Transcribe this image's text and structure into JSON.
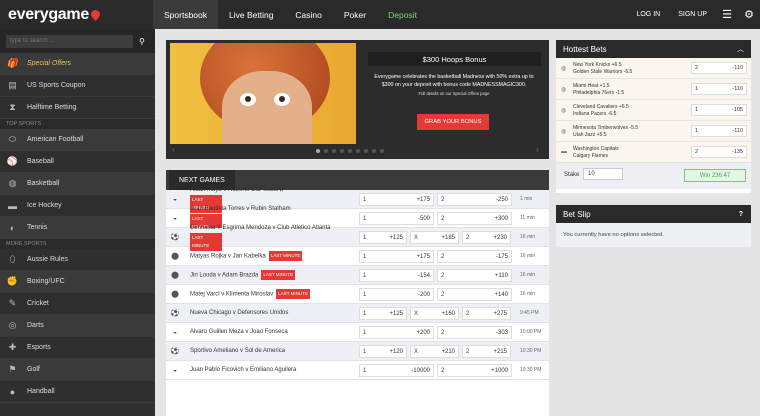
{
  "brand": {
    "name": "everygame",
    "accent": "#e53935"
  },
  "nav": {
    "tabs": [
      {
        "label": "Sportsbook"
      },
      {
        "label": "Live Betting"
      },
      {
        "label": "Casino"
      },
      {
        "label": "Poker"
      },
      {
        "label": "Deposit"
      }
    ],
    "login": "LOG IN",
    "signup": "SIGN UP"
  },
  "sidebar": {
    "search_placeholder": "type to search ...",
    "top_items": [
      {
        "label": "Special Offers",
        "icon": "gift-icon"
      },
      {
        "label": "US Sports Coupon",
        "icon": "ticket-icon"
      },
      {
        "label": "Halftime Betting",
        "icon": "hourglass-icon"
      }
    ],
    "top_sports_header": "TOP SPORTS",
    "top_sports": [
      {
        "label": "American Football",
        "icon": "football-icon"
      },
      {
        "label": "Baseball",
        "icon": "baseball-icon"
      },
      {
        "label": "Basketball",
        "icon": "basketball-icon"
      },
      {
        "label": "Ice Hockey",
        "icon": "hockey-icon"
      },
      {
        "label": "Tennis",
        "icon": "tennis-icon"
      }
    ],
    "more_sports_header": "MORE SPORTS",
    "more_sports": [
      {
        "label": "Aussie Rules",
        "icon": "aussie-ball-icon"
      },
      {
        "label": "Boxing/UFC",
        "icon": "boxing-glove-icon"
      },
      {
        "label": "Cricket",
        "icon": "cricket-icon"
      },
      {
        "label": "Darts",
        "icon": "dartboard-icon"
      },
      {
        "label": "Esports",
        "icon": "gamepad-icon"
      },
      {
        "label": "Golf",
        "icon": "golf-icon"
      },
      {
        "label": "Handball",
        "icon": "handball-icon"
      }
    ]
  },
  "banner": {
    "title": "$300 Hoops Bonus",
    "text": "Everygame celebrates the basketball Madness with 50% extra up to $300 on your deposit with bonus code MADNESSMAGIC300.",
    "note": "Full details on our Special Offers page",
    "cta": "GRAB YOUR BONUS"
  },
  "games": {
    "tab": "NEXT GAMES",
    "tag_label": "LAST MINUTE",
    "rows": [
      {
        "name": "Aidan Mayo v Roberto CID Subervi",
        "tag": "below",
        "o1": "+175",
        "o2": "-250",
        "time": "1 min"
      },
      {
        "name": "Juan Bautista Torres v Rubin Statham",
        "tag": "below",
        "o1": "-500",
        "o2": "+300",
        "time": "11 min"
      },
      {
        "name": "Gimnasia Y Esgrima Mendoza v Club Atletico Atlanta",
        "tag": "after2",
        "o1": "+125",
        "ox": "+185",
        "o2": "+230",
        "time": "16 min"
      },
      {
        "name": "Matyas Rojka v Jan Kabelka",
        "tag": "inline",
        "o1": "+175",
        "o2": "-175",
        "time": "16 min"
      },
      {
        "name": "Jiri Louda v Adam Brazda",
        "tag": "inline",
        "o1": "-154",
        "o2": "+110",
        "time": "16 min"
      },
      {
        "name": "Matej Varcl v Klimenta Miroslav",
        "tag": "inline",
        "o1": "-200",
        "o2": "+140",
        "time": "16 min"
      },
      {
        "name": "Nueva Chicago v Defensores Unidos",
        "tag": "",
        "o1": "+125",
        "ox": "+160",
        "o2": "+275",
        "time": "9:45 PM"
      },
      {
        "name": "Alvaro Guillen Meza v Joao Fonseca",
        "tag": "",
        "o1": "+200",
        "o2": "-303",
        "time": "10:00 PM"
      },
      {
        "name": "Sportivo Ameliano v Sol de America",
        "tag": "",
        "o1": "+120",
        "ox": "+210",
        "o2": "+215",
        "time": "10:30 PM"
      },
      {
        "name": "Juan Pablo Ficovich v Emiliano Aguilera",
        "tag": "",
        "o1": "-10000",
        "o2": "+1000",
        "time": "10:30 PM"
      }
    ],
    "label_1": "1",
    "label_x": "X",
    "label_2": "2"
  },
  "hottest": {
    "title": "Hottest Bets",
    "rows": [
      {
        "t1": "New York Knicks +6.5",
        "t2": "Golden State Warriors -6.5",
        "sel": "2",
        "odds": "-110"
      },
      {
        "t1": "Miami Heat +1.5",
        "t2": "Philadelphia 76ers -1.5",
        "sel": "1",
        "odds": "-110"
      },
      {
        "t1": "Cleveland Cavaliers +6.5",
        "t2": "Indiana Pacers -6.5",
        "sel": "1",
        "odds": "-105"
      },
      {
        "t1": "Minnesota Timberwolves -5.5",
        "t2": "Utah Jazz +5.5",
        "sel": "1",
        "odds": "-110"
      },
      {
        "t1": "Washington Capitals",
        "t2": "Calgary Flames",
        "sel": "2",
        "odds": "-135"
      }
    ],
    "stake_label": "Stake",
    "stake_value": "10",
    "win_label": "Win 236.47"
  },
  "betslip": {
    "title": "Bet Slip",
    "empty": "You currently have no options selected."
  }
}
